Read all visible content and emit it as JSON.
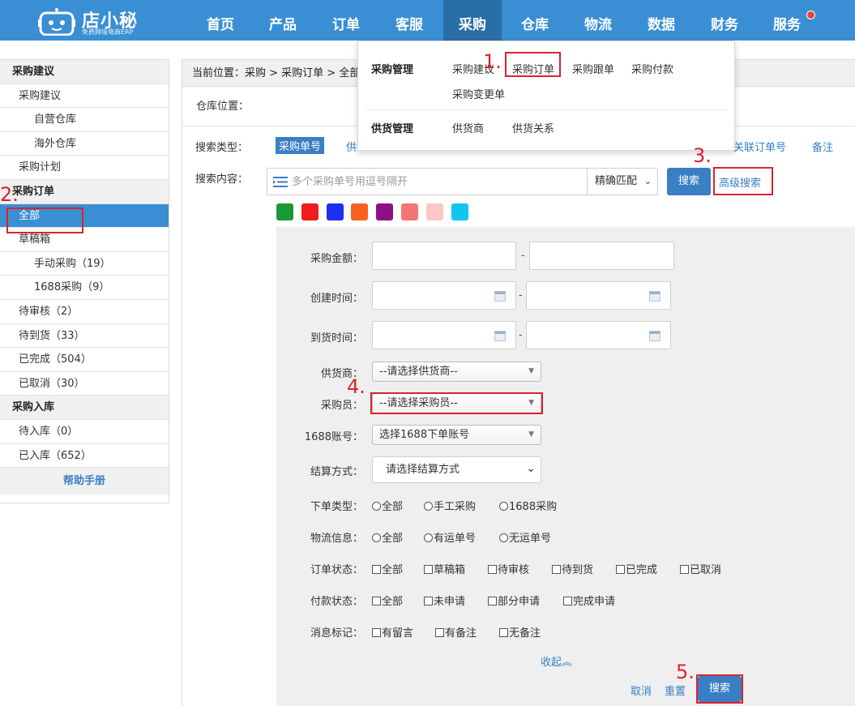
{
  "app": {
    "logo_text": "店小秘",
    "logo_tagline": "免费跨境电商ERP"
  },
  "nav": {
    "items": [
      "首页",
      "产品",
      "订单",
      "客服",
      "采购",
      "仓库",
      "物流",
      "数据",
      "财务",
      "服务"
    ],
    "active": "采购"
  },
  "dropdown": {
    "group1_title": "采购管理",
    "group1_items": [
      "采购建议",
      "采购订单",
      "采购跟单",
      "采购付款",
      "采购变更单"
    ],
    "group2_title": "供货管理",
    "group2_items": [
      "供货商",
      "供货关系"
    ]
  },
  "sidebar": {
    "rows": [
      {
        "label": "采购建议",
        "kind": "head"
      },
      {
        "label": "采购建议",
        "kind": "l1"
      },
      {
        "label": "自营仓库",
        "kind": "l2"
      },
      {
        "label": "海外仓库",
        "kind": "l2"
      },
      {
        "label": "采购计划",
        "kind": "l1"
      },
      {
        "label": "采购订单",
        "kind": "head"
      },
      {
        "label": "全部",
        "kind": "active"
      },
      {
        "label": "草稿箱",
        "kind": "l1"
      },
      {
        "label": "手动采购（19）",
        "kind": "l2"
      },
      {
        "label": "1688采购（9）",
        "kind": "l2"
      },
      {
        "label": "待审核（2）",
        "kind": "l1"
      },
      {
        "label": "待到货（33）",
        "kind": "l1"
      },
      {
        "label": "已完成（504）",
        "kind": "l1"
      },
      {
        "label": "已取消（30）",
        "kind": "l1"
      },
      {
        "label": "采购入库",
        "kind": "head"
      },
      {
        "label": "待入库（0）",
        "kind": "l1"
      },
      {
        "label": "已入库（652）",
        "kind": "l1"
      }
    ],
    "help": "帮助手册"
  },
  "main": {
    "breadcrumb": "当前位置：采购 > 采购订单 > 全部",
    "warehouse_label": "仓库位置：",
    "search_type_label": "搜索类型：",
    "search_type_active": "采购单号",
    "search_type_partial": "供",
    "search_type_right1": "关联订单号",
    "search_type_right2": "备注",
    "search_content_label": "搜索内容：",
    "search_placeholder": "多个采购单号用逗号隔开",
    "match_mode": "精确匹配",
    "search_button": "搜索",
    "advanced_search": "高级搜索",
    "color_tags": [
      "#1a9a34",
      "#f11c1c",
      "#1d2ff0",
      "#f5621f",
      "#8e0f86",
      "#f57575",
      "#fbc8c3",
      "#10c5f0"
    ]
  },
  "advanced": {
    "amount_label": "采购金额：",
    "created_label": "创建时间：",
    "arrival_label": "到货时间：",
    "supplier_label": "供货商：",
    "supplier_value": "--请选择供货商--",
    "buyer_label": "采购员：",
    "buyer_value": "--请选择采购员--",
    "account_label": "1688账号：",
    "account_value": "选择1688下单账号",
    "settle_label": "结算方式：",
    "settle_value": "请选择结算方式",
    "order_type_label": "下单类型：",
    "order_type_opts": [
      "全部",
      "手工采购",
      "1688采购"
    ],
    "logistics_label": "物流信息：",
    "logistics_opts": [
      "全部",
      "有运单号",
      "无运单号"
    ],
    "status_label": "订单状态：",
    "status_opts": [
      "全部",
      "草稿箱",
      "待审核",
      "待到货",
      "已完成",
      "已取消"
    ],
    "pay_label": "付款状态：",
    "pay_opts": [
      "全部",
      "未申请",
      "部分申请",
      "完成申请"
    ],
    "msg_label": "消息标记：",
    "msg_opts": [
      "有留言",
      "有备注",
      "无备注"
    ],
    "collapse": "收起︽",
    "cancel": "取消",
    "reset": "重置",
    "search": "搜索",
    "dash": "-"
  },
  "annotations": {
    "n1": "1.",
    "n2": "2.",
    "n3": "3.",
    "n4": "4.",
    "n5": "5."
  }
}
